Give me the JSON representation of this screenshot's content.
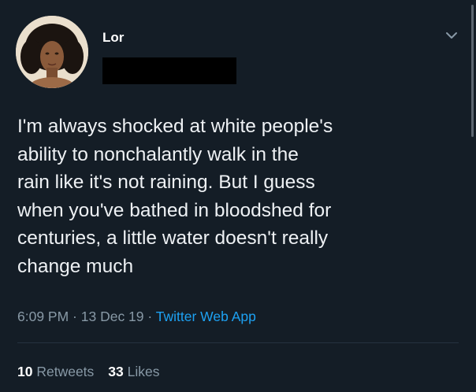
{
  "author": {
    "name": "Lor"
  },
  "tweet": {
    "text_lines": [
      "I'm always shocked at white people's",
      "ability to nonchalantly walk in the",
      "rain like it's not raining. But I guess",
      "when you've bathed in bloodshed for",
      "centuries, a little water doesn't really",
      "change much"
    ],
    "time": "6:09 PM",
    "date": "13 Dec 19",
    "separator": " · ",
    "source": "Twitter Web App"
  },
  "stats": {
    "retweets_count": "10",
    "retweets_label": "Retweets",
    "likes_count": "33",
    "likes_label": "Likes"
  },
  "icons": {
    "menu": "chevron-down-icon"
  },
  "colors": {
    "background": "#141d26",
    "link": "#1da1f2",
    "muted": "#8899a6"
  }
}
